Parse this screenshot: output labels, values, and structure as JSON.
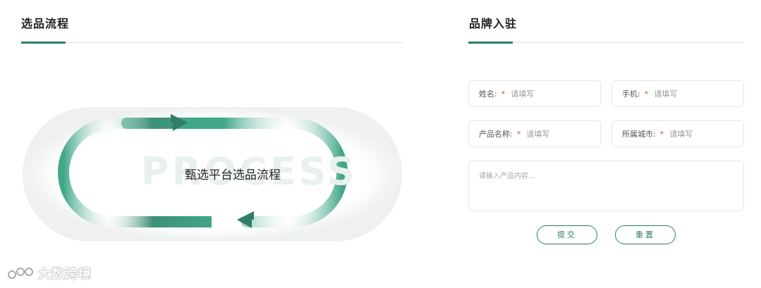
{
  "left_section": {
    "title": "选品流程"
  },
  "right_section": {
    "title": "品牌入驻"
  },
  "process": {
    "watermark_word": "PROCESS",
    "label": "甄选平台选品流程"
  },
  "form": {
    "name": {
      "label": "姓名:",
      "required_mark": "*",
      "placeholder": "请填写"
    },
    "phone": {
      "label": "手机:",
      "required_mark": "*",
      "placeholder": "请填写"
    },
    "product_name": {
      "label": "产品名称:",
      "required_mark": "*",
      "placeholder": "请填写"
    },
    "city": {
      "label": "所属城市:",
      "required_mark": "*",
      "placeholder": "请填写"
    },
    "content": {
      "placeholder": "请输入产品内容..."
    },
    "submit_label": "提交",
    "reset_label": "重置"
  },
  "watermark_logo": {
    "text": "大数跨境"
  },
  "colors": {
    "accent": "#2f7d6a",
    "loop": "#3fa68a",
    "required": "#e0443a"
  }
}
